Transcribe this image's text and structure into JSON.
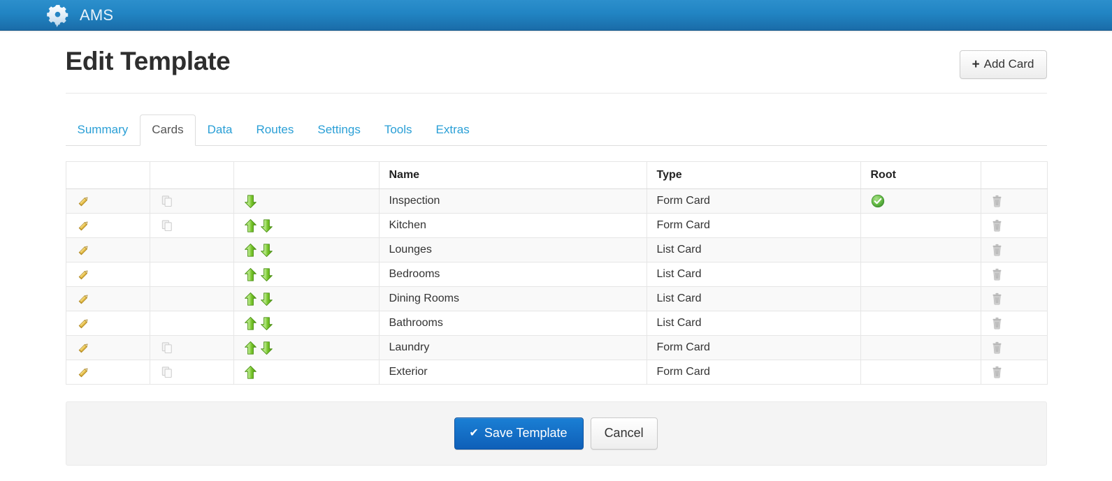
{
  "navbar": {
    "brand": "AMS",
    "logo_icon": "gear-icon",
    "bg_start": "#2c8fcc",
    "bg_end": "#1a6ca8"
  },
  "header": {
    "title": "Edit Template",
    "add_card_label": "Add Card",
    "add_card_icon": "plus-icon"
  },
  "tabs": [
    {
      "label": "Summary",
      "active": false
    },
    {
      "label": "Cards",
      "active": true
    },
    {
      "label": "Data",
      "active": false
    },
    {
      "label": "Routes",
      "active": false
    },
    {
      "label": "Settings",
      "active": false
    },
    {
      "label": "Tools",
      "active": false
    },
    {
      "label": "Extras",
      "active": false
    }
  ],
  "table": {
    "columns": [
      "",
      "",
      "",
      "Name",
      "Type",
      "Root",
      ""
    ],
    "headers": {
      "edit": "",
      "copy": "",
      "move": "",
      "name": "Name",
      "type": "Type",
      "root": "Root",
      "delete": ""
    },
    "rows": [
      {
        "name": "Inspection",
        "type": "Form Card",
        "root": true,
        "copy": true,
        "move_up": false,
        "move_down": true
      },
      {
        "name": "Kitchen",
        "type": "Form Card",
        "root": false,
        "copy": true,
        "move_up": true,
        "move_down": true
      },
      {
        "name": "Lounges",
        "type": "List Card",
        "root": false,
        "copy": false,
        "move_up": true,
        "move_down": true
      },
      {
        "name": "Bedrooms",
        "type": "List Card",
        "root": false,
        "copy": false,
        "move_up": true,
        "move_down": true
      },
      {
        "name": "Dining Rooms",
        "type": "List Card",
        "root": false,
        "copy": false,
        "move_up": true,
        "move_down": true
      },
      {
        "name": "Bathrooms",
        "type": "List Card",
        "root": false,
        "copy": false,
        "move_up": true,
        "move_down": true
      },
      {
        "name": "Laundry",
        "type": "Form Card",
        "root": false,
        "copy": true,
        "move_up": true,
        "move_down": true
      },
      {
        "name": "Exterior",
        "type": "Form Card",
        "root": false,
        "copy": true,
        "move_up": true,
        "move_down": false
      }
    ],
    "row_icons": {
      "edit": "pencil-icon",
      "copy": "copy-icon",
      "move_up": "arrow-up-icon",
      "move_down": "arrow-down-icon",
      "root": "check-circle-icon",
      "delete": "trash-icon"
    }
  },
  "footer": {
    "save_label": "Save Template",
    "save_icon": "check-icon",
    "cancel_label": "Cancel"
  },
  "colors": {
    "accent_blue": "#2a9fd6",
    "primary_button": "#0f5fb8",
    "arrow_green": "#6abf2f",
    "pencil_gold": "#e8c44a",
    "check_green": "#5cb85c"
  }
}
